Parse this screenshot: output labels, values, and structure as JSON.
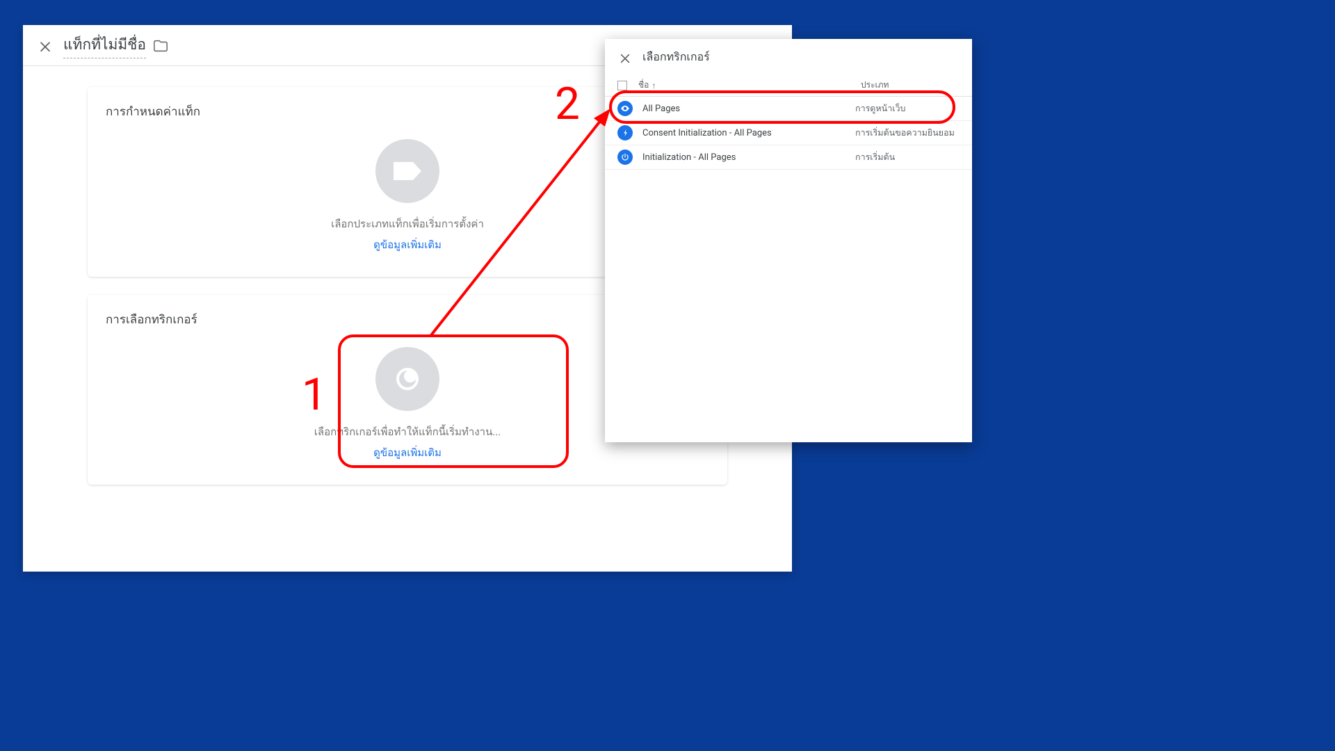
{
  "main": {
    "tag_name": "แท็กที่ไม่มีชื่อ",
    "card_config": {
      "title": "การกำหนดค่าแท็ก",
      "empty_text": "เลือกประเภทแท็กเพื่อเริ่มการตั้งค่า",
      "link_text": "ดูข้อมูลเพิ่มเติม"
    },
    "card_trigger": {
      "title": "การเลือกทริกเกอร์",
      "empty_text": "เลือกทริกเกอร์เพื่อทำให้แท็กนี้เริ่มทำงาน...",
      "link_text": "ดูข้อมูลเพิ่มเติม"
    }
  },
  "side": {
    "title": "เลือกทริกเกอร์",
    "col_name": "ชื่อ",
    "col_type": "ประเภท",
    "rows": [
      {
        "icon": "eye",
        "name": "All Pages",
        "type": "การดูหน้าเว็บ"
      },
      {
        "icon": "bolt",
        "name": "Consent Initialization - All Pages",
        "type": "การเริ่มต้นขอความยินยอม"
      },
      {
        "icon": "power",
        "name": "Initialization - All Pages",
        "type": "การเริ่มต้น"
      }
    ]
  },
  "annotations": {
    "label1": "1",
    "label2": "2"
  }
}
